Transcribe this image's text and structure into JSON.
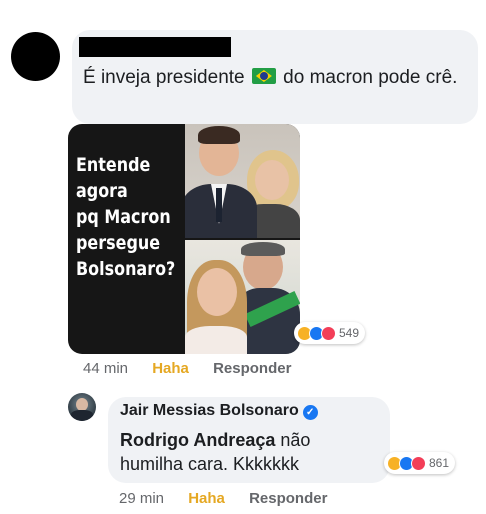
{
  "comment": {
    "text_before_flag": "É inveja presidente",
    "flag_icon": "brazil-flag-icon",
    "text_after_flag": "do macron pode crê."
  },
  "meme": {
    "lines": [
      "Entende",
      "agora",
      "pq Macron",
      "persegue",
      "Bolsonaro?"
    ]
  },
  "comment_reactions": {
    "icons": [
      "haha-icon",
      "like-icon",
      "love-icon"
    ],
    "count": "549"
  },
  "comment_actions": {
    "time": "44 min",
    "haha": "Haha",
    "reply": "Responder"
  },
  "reply": {
    "author": "Jair Messias Bolsonaro",
    "mention": "Rodrigo Andreaça",
    "text": "não humilha cara. Kkkkkkk",
    "reactions_count": "861",
    "time": "29 min",
    "haha": "Haha",
    "reply_label": "Responder"
  },
  "colors": {
    "bubble": "#f0f2f5",
    "haha_active": "#e5a823",
    "secondary_text": "#65676b",
    "verified": "#1877f2"
  }
}
